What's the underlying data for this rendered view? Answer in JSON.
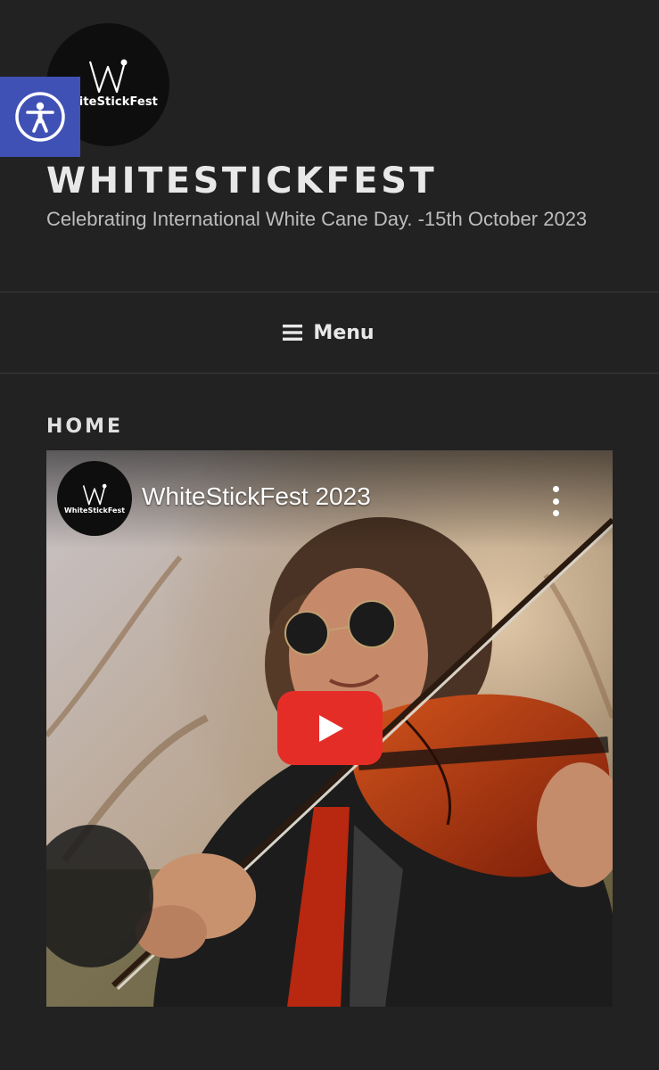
{
  "header": {
    "logo_text": "WhiteStickFest",
    "title": "WHITESTICKFEST",
    "description": "Celebrating International White Cane Day. -15th October 2023"
  },
  "accessibility_button": {
    "icon": "accessibility-icon",
    "color": "#3f51b5"
  },
  "nav": {
    "menu_label": "Menu",
    "icon": "hamburger-icon"
  },
  "main": {
    "heading": "HOME",
    "video": {
      "channel_logo_text": "WhiteStickFest",
      "title": "WhiteStickFest 2023",
      "play_icon": "play-icon",
      "more_icon": "more-vert-icon",
      "play_color": "#e52d27"
    }
  }
}
